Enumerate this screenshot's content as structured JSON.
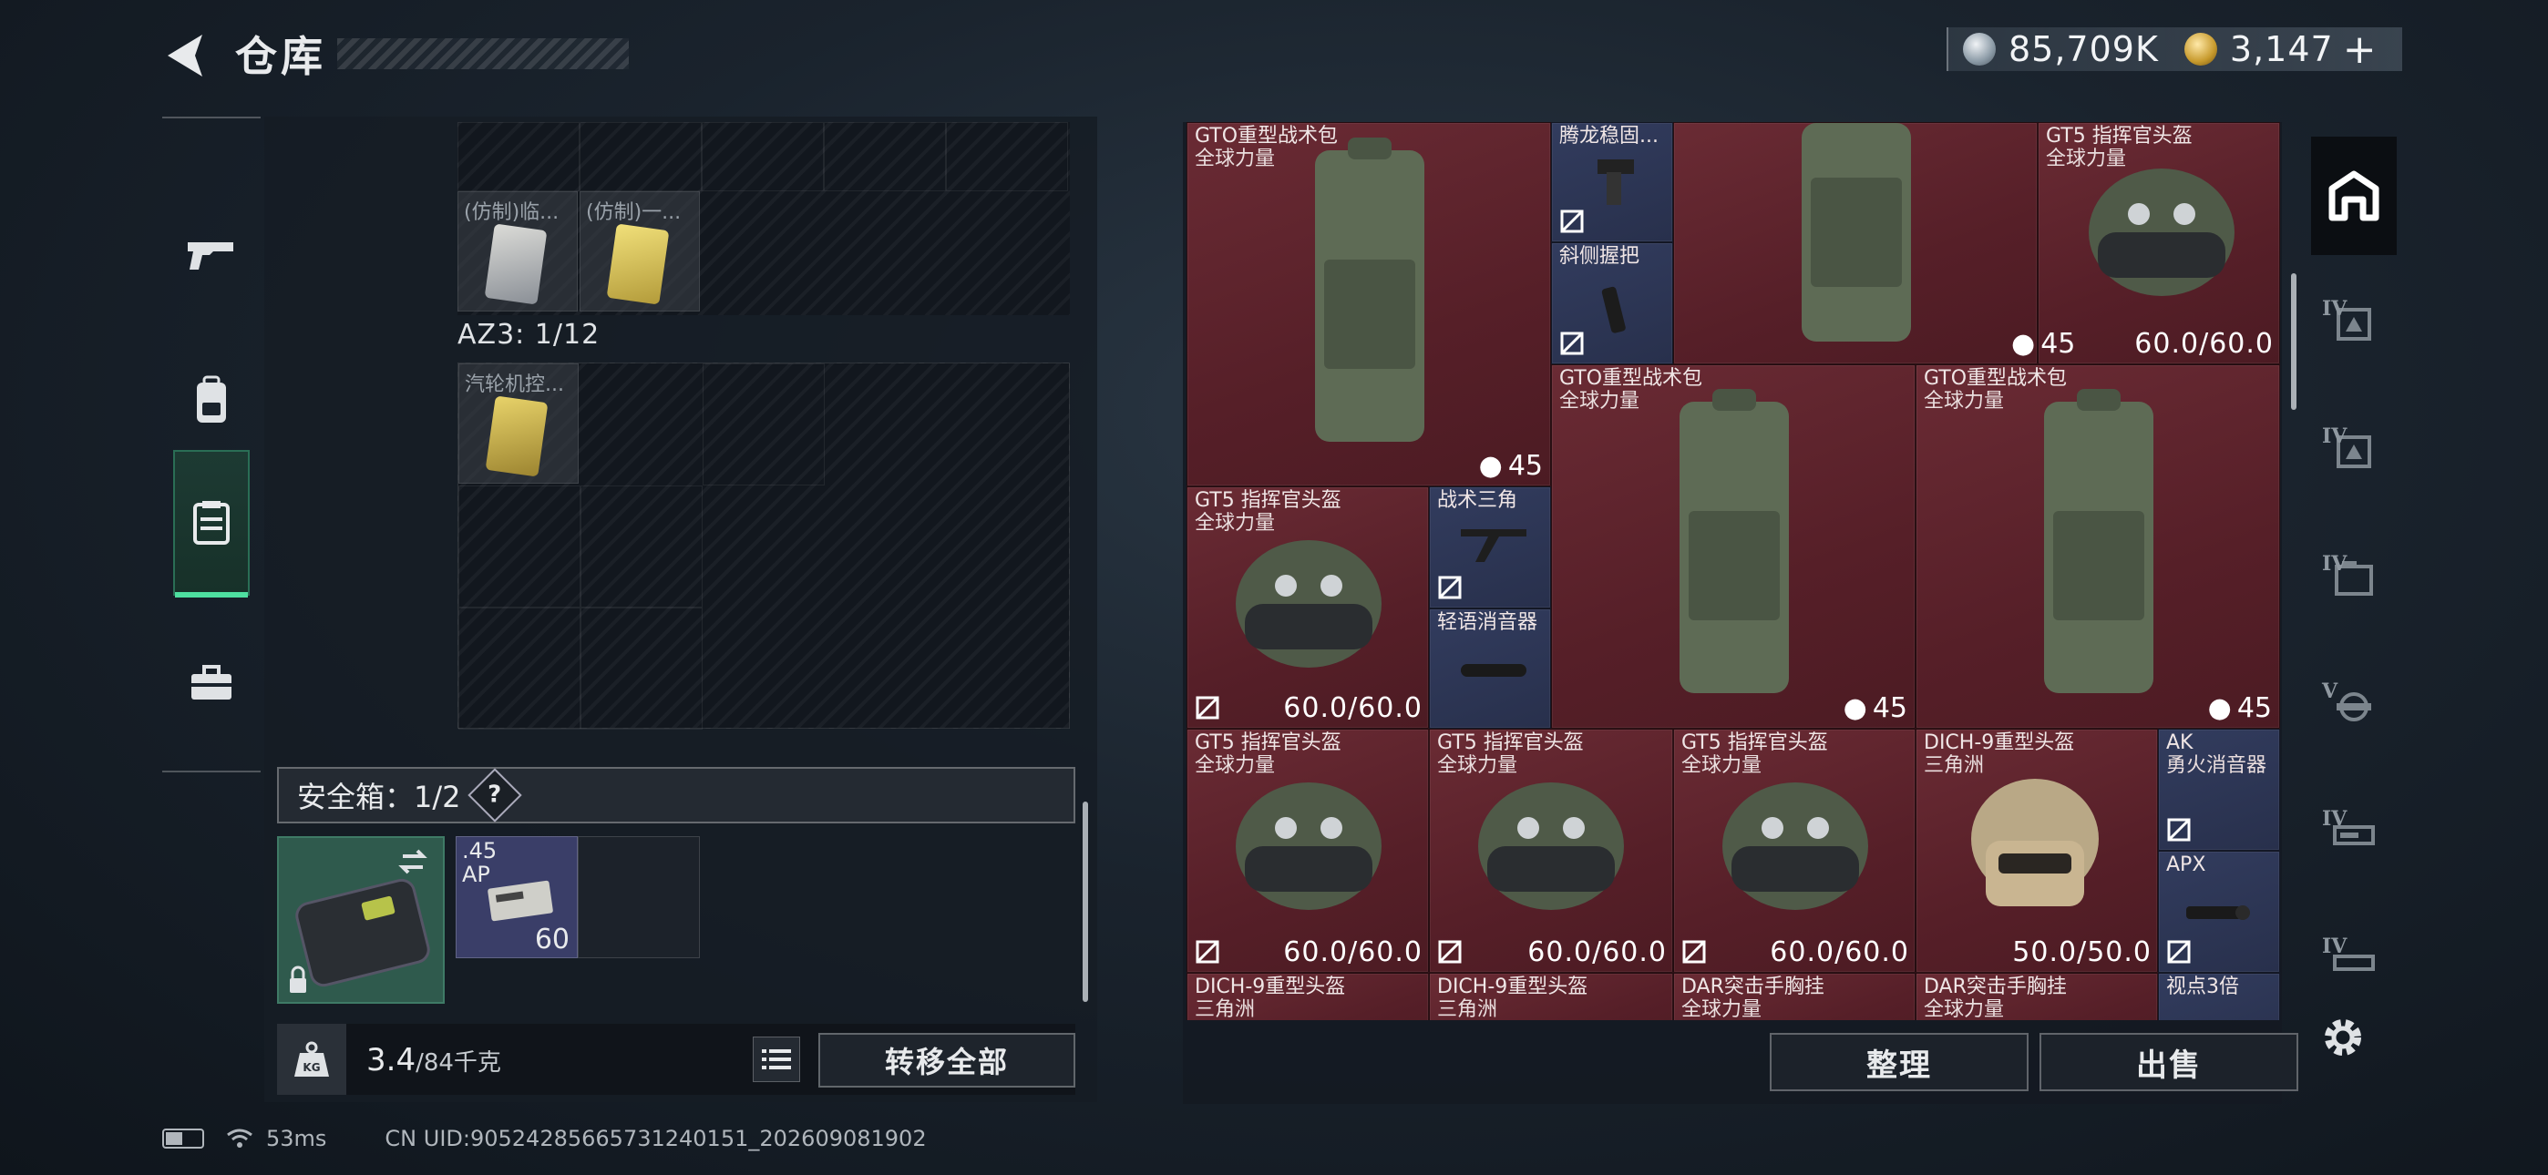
{
  "header": {
    "title": "仓库",
    "silver_amount": "85,709K",
    "gold_amount": "3,147",
    "add_symbol": "+"
  },
  "left_nav": [
    "weapon",
    "backpack",
    "chest-rig",
    "toolbox"
  ],
  "left_panel": {
    "top_items": [
      {
        "name": "(仿制)临..."
      },
      {
        "name": "(仿制)一..."
      }
    ],
    "az3_label": "AZ3: 1/12",
    "az3_items": [
      {
        "name": "汽轮机控..."
      }
    ],
    "safe_label": "安全箱：1/2",
    "safe_help": "?",
    "ammo": {
      "name": ".45",
      "sub": "AP",
      "count": "60"
    },
    "weight_value": "3.4",
    "weight_max": "/84千克",
    "transfer_button": "转移全部"
  },
  "right_grid": {
    "items": [
      {
        "name": "GTO重型战术包",
        "sub": "全球力量",
        "count": "45"
      },
      {
        "name": "腾龙稳固...",
        "sub": ""
      },
      {
        "name": "斜侧握把",
        "sub": ""
      },
      {
        "name": "GT5 指挥官头盔",
        "sub": "全球力量",
        "value": "60.0/60.0",
        "count": "45"
      },
      {
        "name": "GTO重型战术包",
        "sub": "全球力量",
        "count": "45"
      },
      {
        "name": "GTO重型战术包",
        "sub": "全球力量",
        "count": "45"
      },
      {
        "name": "GT5 指挥官头盔",
        "sub": "全球力量",
        "value": "60.0/60.0"
      },
      {
        "name": "战术三角",
        "sub": ""
      },
      {
        "name": "轻语消音器",
        "sub": ""
      },
      {
        "name": "GT5 指挥官头盔",
        "sub": "全球力量",
        "value": "60.0/60.0"
      },
      {
        "name": "GT5 指挥官头盔",
        "sub": "全球力量",
        "value": "60.0/60.0"
      },
      {
        "name": "GT5 指挥官头盔",
        "sub": "全球力量",
        "value": "60.0/60.0"
      },
      {
        "name": "DICH-9重型头盔",
        "sub": "三角洲",
        "value": "50.0/50.0"
      },
      {
        "name": "AK",
        "sub": "勇火消音器"
      },
      {
        "name": "APX",
        "sub": ""
      },
      {
        "name": "DICH-9重型头盔",
        "sub": "三角洲"
      },
      {
        "name": "DICH-9重型头盔",
        "sub": "三角洲"
      },
      {
        "name": "DAR突击手胸挂",
        "sub": "全球力量"
      },
      {
        "name": "DAR突击手胸挂",
        "sub": "全球力量"
      },
      {
        "name": "视点3倍",
        "sub": ""
      }
    ],
    "sort_button": "整理",
    "sell_button": "出售"
  },
  "right_tabs": [
    {
      "tier": "",
      "icon": "home-storage-icon"
    },
    {
      "tier": "IV",
      "icon": "storage-tier-icon"
    },
    {
      "tier": "IV",
      "icon": "storage-tier-icon"
    },
    {
      "tier": "IV",
      "icon": "storage-tier-icon"
    },
    {
      "tier": "V",
      "icon": "storage-tier-icon"
    },
    {
      "tier": "IV",
      "icon": "storage-tier-icon"
    },
    {
      "tier": "IV",
      "icon": "storage-tier-icon"
    }
  ],
  "footer": {
    "ping": "53ms",
    "uid": "CN UID:9052428566573124015​1_202609081902"
  },
  "colors": {
    "item_red": "#5a222b",
    "item_navy": "#2c3552",
    "active_green": "#4ee0a0"
  }
}
